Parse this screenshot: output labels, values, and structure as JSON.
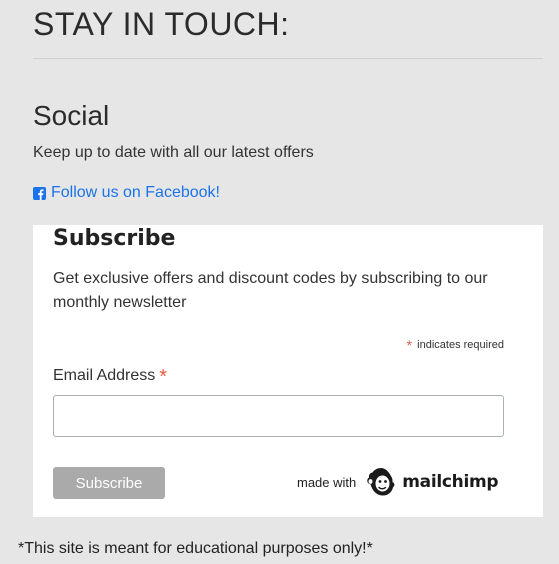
{
  "header": {
    "title": "STAY IN TOUCH:"
  },
  "social": {
    "heading": "Social",
    "description": "Keep up to date with all our latest offers",
    "facebook_link": "Follow us on Facebook!",
    "facebook_icon": "facebook-square-icon"
  },
  "subscribe": {
    "heading": "Subscribe",
    "description": "Get exclusive offers and discount codes by subscribing to our monthly newsletter",
    "required_asterisk": "*",
    "required_note": "indicates required",
    "email_label": "Email Address",
    "email_asterisk": "*",
    "email_value": "",
    "button_label": "Subscribe",
    "made_with": "made with",
    "brand_wordmark": "mailchimp",
    "brand_icon": "mailchimp-freddie-icon"
  },
  "footer": {
    "note": "*This site is meant for educational purposes only!*"
  },
  "colors": {
    "background": "#e6e6e6",
    "card": "#ffffff",
    "link": "#1a73e8",
    "required": "#e85c41",
    "button": "#aaaaaa"
  }
}
